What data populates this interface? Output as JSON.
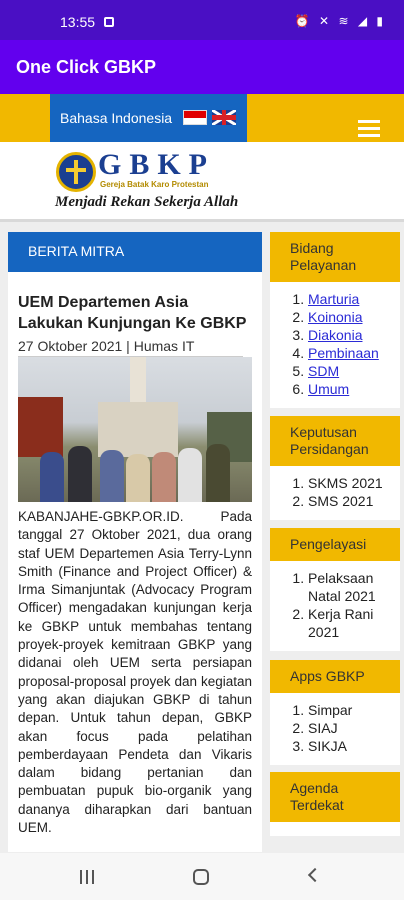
{
  "status": {
    "time": "13:55",
    "icons": "⏰ ✕ ≋ ◢ ▮"
  },
  "app": {
    "title": "One Click GBKP"
  },
  "header": {
    "language_label": "Bahasa Indonesia"
  },
  "logo": {
    "name": "GBKP",
    "subtitle": "Gereja Batak Karo Protestan",
    "motto": "Menjadi Rekan Sekerja Allah"
  },
  "main": {
    "section_title": "BERITA MITRA",
    "headline": "UEM Departemen Asia Lakukan Kunjungan Ke GBKP",
    "date_author": "27 Oktober 2021 | Humas IT",
    "body": "KABANJAHE-GBKP.OR.ID. Pada tanggal 27 Oktober 2021, dua orang staf UEM Departemen Asia Terry-Lynn Smith (Finance and Project Officer) & Irma Simanjuntak (Advocacy Program Officer) mengadakan kunjungan kerja ke GBKP untuk membahas tentang proyek-proyek kemitraan GBKP yang didanai oleh UEM serta persiapan proposal-proposal proyek dan kegiatan yang akan diajukan GBKP di tahun depan. Untuk tahun depan, GBKP akan focus pada pelatihan pemberdayaan Pendeta dan Vikaris dalam bidang pertanian dan pembuatan pupuk bio-organik yang dananya diharapkan dari bantuan UEM."
  },
  "sidebar": [
    {
      "title": "Bidang Pelayanan",
      "items": [
        "Marturia",
        "Koinonia",
        "Diakonia",
        "Pembinaan",
        "SDM",
        "Umum"
      ]
    },
    {
      "title": "Keputusan Persidangan",
      "items": [
        "SKMS 2021",
        "SMS 2021"
      ]
    },
    {
      "title": "Pengelayasi",
      "items": [
        "Pelaksaan Natal 2021",
        "Kerja Rani 2021"
      ]
    },
    {
      "title": "Apps GBKP",
      "items": [
        "Simpar",
        "SIAJ",
        "SIKJA"
      ]
    },
    {
      "title": "Agenda Terdekat",
      "items": []
    }
  ]
}
